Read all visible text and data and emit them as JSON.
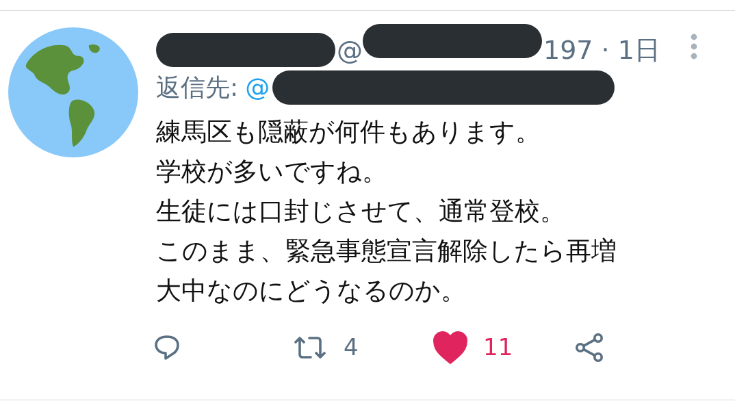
{
  "tweet": {
    "handle_visible": "@",
    "handle_tail": "197 · 1日",
    "reply_label": "返信先:",
    "reply_handle_visible": "@",
    "body_lines": [
      "練馬区も隠蔽が何件もあります。",
      "学校が多いですね。",
      "生徒には口封じさせて、通常登校。",
      "このまま、緊急事態宣言解除したら再増",
      "大中なのにどうなるのか。"
    ],
    "actions": [
      {
        "kind": "reply"
      },
      {
        "kind": "retweet",
        "count": "4"
      },
      {
        "kind": "like",
        "count": "11",
        "liked": true
      },
      {
        "kind": "share"
      }
    ]
  }
}
